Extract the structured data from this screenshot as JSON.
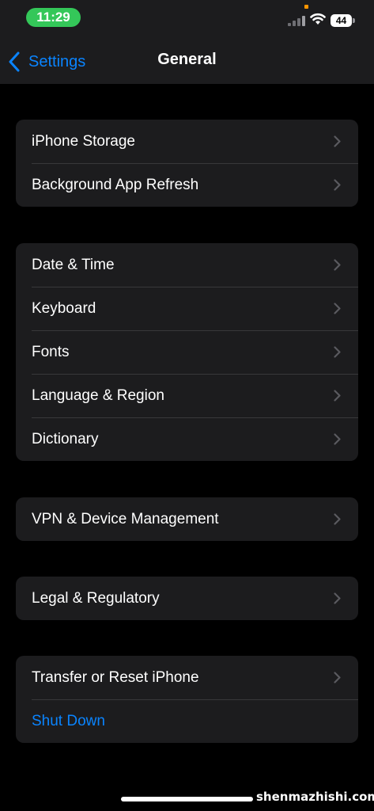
{
  "status_bar": {
    "time": "11:29",
    "battery": "44",
    "accent": "#34c759"
  },
  "nav": {
    "back_label": "Settings",
    "title": "General"
  },
  "groups": [
    {
      "rows": [
        "iPhone Storage",
        "Background App Refresh"
      ]
    },
    {
      "rows": [
        "Date & Time",
        "Keyboard",
        "Fonts",
        "Language & Region",
        "Dictionary"
      ]
    },
    {
      "rows": [
        "VPN & Device Management"
      ]
    },
    {
      "rows": [
        "Legal & Regulatory"
      ]
    },
    {
      "rows": [
        "Transfer or Reset iPhone"
      ],
      "action": "Shut Down"
    }
  ],
  "colors": {
    "link": "#0a84ff",
    "cell": "#1c1c1e",
    "background": "#000000"
  },
  "watermark": "shenmazhishi.com"
}
